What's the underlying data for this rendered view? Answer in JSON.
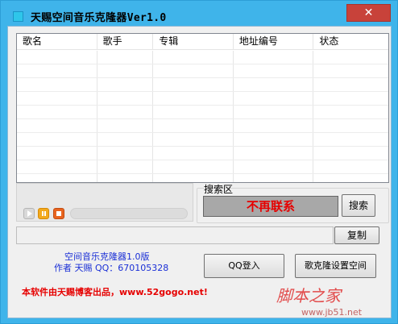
{
  "window": {
    "title": "天赐空间音乐克隆器Ver1.0",
    "close_label": "✕"
  },
  "table": {
    "columns": [
      "歌名",
      "歌手",
      "专辑",
      "地址编号",
      "状态"
    ],
    "rows": [
      [
        "",
        "",
        "",
        "",
        ""
      ],
      [
        "",
        "",
        "",
        "",
        ""
      ],
      [
        "",
        "",
        "",
        "",
        ""
      ],
      [
        "",
        "",
        "",
        "",
        ""
      ],
      [
        "",
        "",
        "",
        "",
        ""
      ],
      [
        "",
        "",
        "",
        "",
        ""
      ],
      [
        "",
        "",
        "",
        "",
        ""
      ],
      [
        "",
        "",
        "",
        "",
        ""
      ],
      [
        "",
        "",
        "",
        "",
        ""
      ],
      [
        "",
        "",
        "",
        "",
        ""
      ]
    ]
  },
  "search": {
    "label": "搜索区",
    "box_text": "不再联系",
    "button_label": "搜索"
  },
  "address": {
    "value": "",
    "copy_label": "复制"
  },
  "footer": {
    "title": "空间音乐克隆器1.0版",
    "author": "作者 天赐 QQ：670105328",
    "qq_login_label": "QQ登入",
    "set_space_label": "歌克隆设置空间",
    "credit": "本软件由天赐博客出品，www.52gogo.net!"
  },
  "watermark": {
    "text": "脚本之家",
    "url": "www.jb51.net"
  },
  "colors": {
    "title_bar": "#3fb4ea",
    "close_button": "#c8423a",
    "search_text": "#e60000",
    "info_text": "#1a2fd6",
    "credit_text": "#e60000"
  },
  "icons": [
    "app-icon",
    "close-icon",
    "play-icon",
    "pause-icon",
    "stop-icon"
  ]
}
